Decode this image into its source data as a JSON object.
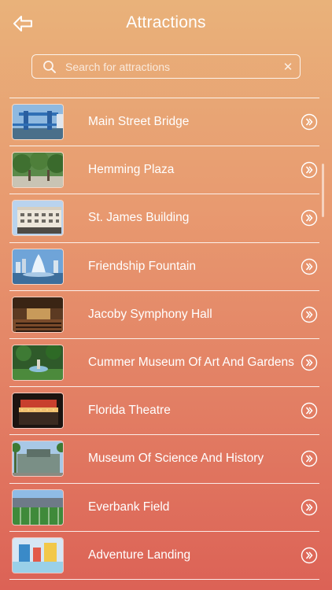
{
  "header": {
    "title": "Attractions",
    "back_icon": "back-arrow-icon"
  },
  "search": {
    "placeholder": "Search for attractions",
    "value": "",
    "icon": "search-icon",
    "clear_icon": "close-icon"
  },
  "attractions": [
    {
      "label": "Main Street Bridge",
      "thumb": "blue-bridge-photo"
    },
    {
      "label": "Hemming Plaza",
      "thumb": "park-plaza-photo"
    },
    {
      "label": "St. James Building",
      "thumb": "white-building-photo"
    },
    {
      "label": "Friendship Fountain",
      "thumb": "fountain-photo"
    },
    {
      "label": "Jacoby Symphony Hall",
      "thumb": "concert-hall-photo"
    },
    {
      "label": "Cummer Museum Of Art And Gardens",
      "thumb": "gardens-photo"
    },
    {
      "label": "Florida Theatre",
      "thumb": "theatre-marquee-photo"
    },
    {
      "label": "Museum Of Science And History",
      "thumb": "museum-facade-photo"
    },
    {
      "label": "Everbank Field",
      "thumb": "stadium-photo"
    },
    {
      "label": "Adventure Landing",
      "thumb": "water-park-photo"
    }
  ],
  "colors": {
    "gradient_top": "#e9b27a",
    "gradient_bottom": "#dc6256",
    "foreground": "#ffffff"
  }
}
